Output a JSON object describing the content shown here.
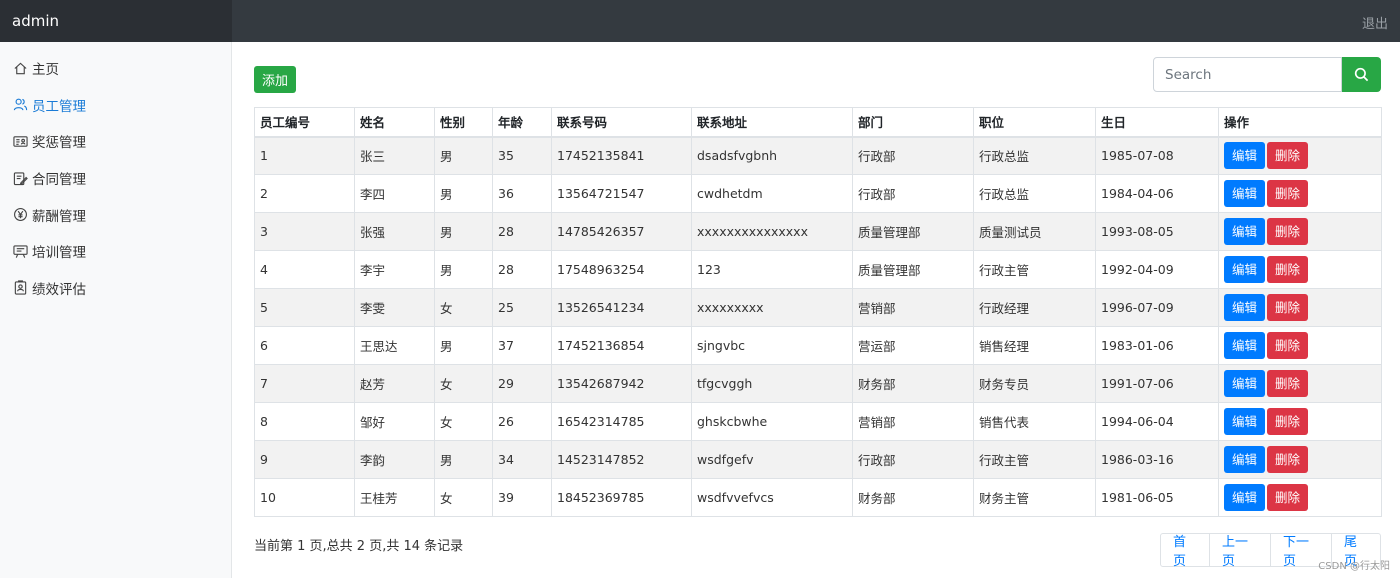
{
  "navbar": {
    "brand": "admin",
    "logout": "退出"
  },
  "sidebar": {
    "items": [
      {
        "label": "主页",
        "icon": "home-icon"
      },
      {
        "label": "员工管理",
        "icon": "users-icon",
        "active": true
      },
      {
        "label": "奖惩管理",
        "icon": "id-card-icon"
      },
      {
        "label": "合同管理",
        "icon": "edit-document-icon"
      },
      {
        "label": "薪酬管理",
        "icon": "yen-circle-icon"
      },
      {
        "label": "培训管理",
        "icon": "chalkboard-icon"
      },
      {
        "label": "绩效评估",
        "icon": "clipboard-user-icon"
      }
    ]
  },
  "toolbar": {
    "add_label": "添加",
    "search_placeholder": "Search",
    "search_icon": "search-icon"
  },
  "table": {
    "headers": [
      "员工编号",
      "姓名",
      "性别",
      "年龄",
      "联系号码",
      "联系地址",
      "部门",
      "职位",
      "生日",
      "操作"
    ],
    "edit_label": "编辑",
    "delete_label": "删除",
    "rows": [
      [
        "1",
        "张三",
        "男",
        "35",
        "17452135841",
        "dsadsfvgbnh",
        "行政部",
        "行政总监",
        "1985-07-08"
      ],
      [
        "2",
        "李四",
        "男",
        "36",
        "13564721547",
        "cwdhetdm",
        "行政部",
        "行政总监",
        "1984-04-06"
      ],
      [
        "3",
        "张强",
        "男",
        "28",
        "14785426357",
        "xxxxxxxxxxxxxxx",
        "质量管理部",
        "质量测试员",
        "1993-08-05"
      ],
      [
        "4",
        "李宇",
        "男",
        "28",
        "17548963254",
        "123",
        "质量管理部",
        "行政主管",
        "1992-04-09"
      ],
      [
        "5",
        "李雯",
        "女",
        "25",
        "13526541234",
        "xxxxxxxxx",
        "营销部",
        "行政经理",
        "1996-07-09"
      ],
      [
        "6",
        "王思达",
        "男",
        "37",
        "17452136854",
        "sjngvbc",
        "营运部",
        "销售经理",
        "1983-01-06"
      ],
      [
        "7",
        "赵芳",
        "女",
        "29",
        "13542687942",
        "tfgcvggh",
        "财务部",
        "财务专员",
        "1991-07-06"
      ],
      [
        "8",
        "邹好",
        "女",
        "26",
        "16542314785",
        "ghskcbwhe",
        "营销部",
        "销售代表",
        "1994-06-04"
      ],
      [
        "9",
        "李韵",
        "男",
        "34",
        "14523147852",
        "wsdfgefv",
        "行政部",
        "行政主管",
        "1986-03-16"
      ],
      [
        "10",
        "王桂芳",
        "女",
        "39",
        "18452369785",
        "wsdfvvefvcs",
        "财务部",
        "财务主管",
        "1981-06-05"
      ]
    ]
  },
  "pagination": {
    "info": "当前第 1 页,总共 2 页,共 14 条记录",
    "first": "首页",
    "prev": "上一页",
    "next": "下一页",
    "last": "尾页"
  },
  "watermark": "CSDN @行太阳",
  "colors": {
    "navbar": "#343a40",
    "success": "#28a745",
    "primary": "#007bff",
    "danger": "#dc3545",
    "active_link": "#1a7bd6"
  }
}
